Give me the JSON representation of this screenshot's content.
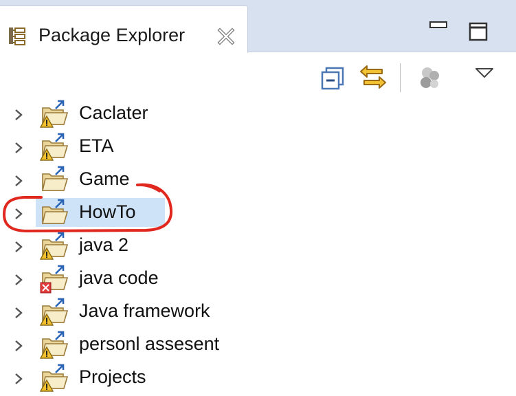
{
  "view": {
    "title": "Package Explorer",
    "icons": {
      "view": "package-explorer-icon",
      "close": "close-icon",
      "minimize": "minimize-icon",
      "maximize": "maximize-icon"
    }
  },
  "toolbar": {
    "buttons": [
      "collapse-all-icon",
      "link-with-editor-icon",
      "focus-on-active-task-icon",
      "view-menu-icon"
    ]
  },
  "tree": {
    "items": [
      {
        "label": "Caclater",
        "icon": "project-warning-icon"
      },
      {
        "label": "ETA",
        "icon": "project-warning-icon"
      },
      {
        "label": "Game",
        "icon": "project-folder-icon"
      },
      {
        "label": "HowTo",
        "icon": "project-folder-icon",
        "selected": true
      },
      {
        "label": "java 2",
        "icon": "project-warning-icon"
      },
      {
        "label": "java code",
        "icon": "project-error-icon"
      },
      {
        "label": "Java framework",
        "icon": "project-warning-icon"
      },
      {
        "label": "personl assesent",
        "icon": "project-warning-icon"
      },
      {
        "label": "Projects",
        "icon": "project-warning-icon"
      }
    ]
  },
  "colors": {
    "header_band": "#d7e1f0",
    "selection": "#cfe3f8",
    "annotation_red": "#e0281e",
    "warning_yellow": "#f2c230",
    "error_red": "#e23b3b"
  }
}
